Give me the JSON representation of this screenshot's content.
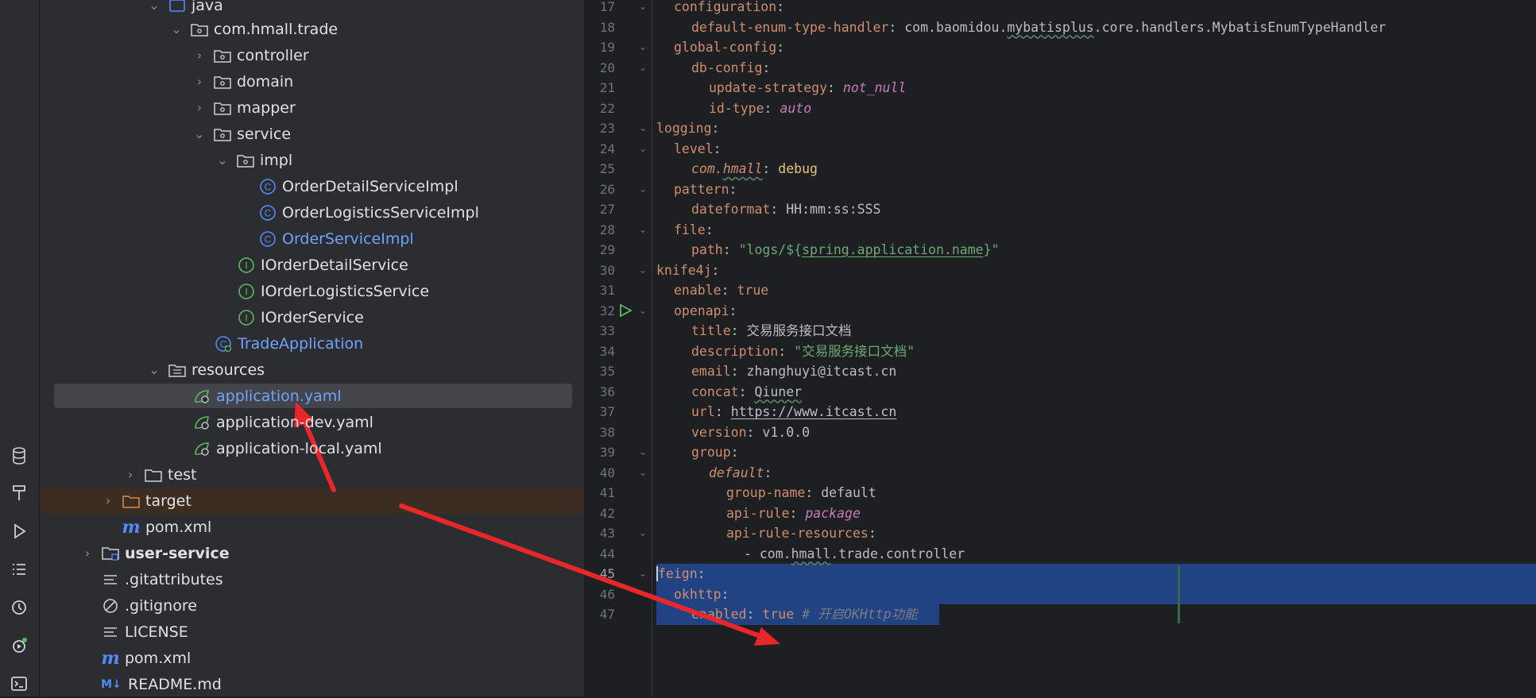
{
  "tree": {
    "java": "java",
    "package": "com.hmall.trade",
    "folders": [
      "controller",
      "domain",
      "mapper",
      "service"
    ],
    "impl": "impl",
    "impl_classes": [
      "OrderDetailServiceImpl",
      "OrderLogisticsServiceImpl",
      "OrderServiceImpl"
    ],
    "interfaces": [
      "IOrderDetailService",
      "IOrderLogisticsService",
      "IOrderService"
    ],
    "app_class": "TradeApplication",
    "resources": "resources",
    "resource_files": [
      "application.yaml",
      "application-dev.yaml",
      "application-local.yaml"
    ],
    "test": "test",
    "target": "target",
    "module_pom": "pom.xml",
    "user_service": "user-service",
    "root_files": [
      ".gitattributes",
      ".gitignore",
      "LICENSE",
      "pom.xml",
      "README.md"
    ]
  },
  "editor": {
    "line_numbers": [
      "17",
      "18",
      "19",
      "20",
      "21",
      "22",
      "23",
      "24",
      "25",
      "26",
      "27",
      "28",
      "29",
      "30",
      "31",
      "32",
      "33",
      "34",
      "35",
      "36",
      "37",
      "38",
      "39",
      "40",
      "41",
      "42",
      "43",
      "44",
      "45",
      "46",
      "47"
    ],
    "l17": "configuration",
    "l18_key": "default-enum-type-handler",
    "l18_p1": "com.baomidou.",
    "l18_p2": "mybatisplus",
    "l18_p3": ".core.handlers.MybatisEnumTypeHandler",
    "l19": "global-config",
    "l20": "db-config",
    "l21_key": "update-strategy",
    "l21_val": "not_null",
    "l22_key": "id-type",
    "l22_val": "auto",
    "l23": "logging",
    "l24": "level",
    "l25_k1": "com.",
    "l25_k2": "hmall",
    "l25_val": "debug",
    "l26": "pattern",
    "l27_key": "dateformat",
    "l27_val": "HH:mm:ss:SSS",
    "l28": "file",
    "l29_key": "path",
    "l29_q1": "\"logs/${",
    "l29_q2": "spring.application.name",
    "l29_q3": "}\"",
    "l30": "knife4j",
    "l31_key": "enable",
    "l31_val": "true",
    "l32": "openapi",
    "l33_key": "title",
    "l33_val": "交易服务接口文档",
    "l34_key": "description",
    "l34_val": "\"交易服务接口文档\"",
    "l35_key": "email",
    "l35_val": "zhanghuyi@itcast.cn",
    "l36_key": "concat",
    "l36_val": "Qiuner",
    "l37_key": "url",
    "l37_val": "https://www.itcast.cn",
    "l38_key": "version",
    "l38_val": "v1.0.0",
    "l39": "group",
    "l40": "default",
    "l41_key": "group-name",
    "l41_val": "default",
    "l42_key": "api-rule",
    "l42_val": "package",
    "l43": "api-rule-resources",
    "l44_p1": "- com.",
    "l44_p2": "hmall",
    "l44_p3": ".trade.controller",
    "l45": "feign",
    "l46": "okhttp",
    "l47_key": "enabled",
    "l47_val": "true",
    "l47_comment": "# 开启OKHttp功能"
  },
  "colors": {
    "arrow": "#e8272a",
    "selection": "#214283",
    "key": "#cf8e6d",
    "string": "#6aab73"
  }
}
